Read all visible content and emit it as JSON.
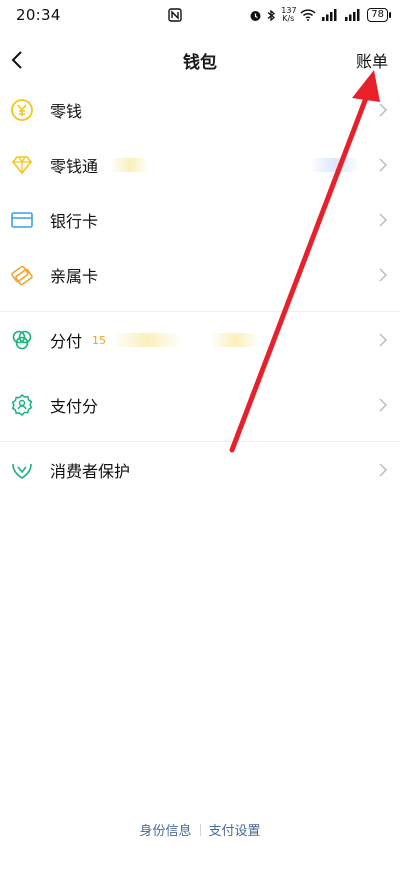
{
  "status": {
    "time": "20:34",
    "speed_top": "137",
    "speed_bottom": "K/s",
    "battery": "78"
  },
  "nav": {
    "title": "钱包",
    "right": "账单"
  },
  "list": [
    {
      "label": "零钱",
      "icon": "coin-icon"
    },
    {
      "label": "零钱通",
      "icon": "diamond-icon"
    },
    {
      "label": "银行卡",
      "icon": "card-icon"
    },
    {
      "label": "亲属卡",
      "icon": "family-card-icon"
    },
    {
      "label": "分付",
      "badge": "15",
      "icon": "installment-icon"
    },
    {
      "label": "支付分",
      "icon": "payscore-icon"
    },
    {
      "label": "消费者保护",
      "icon": "protection-icon"
    }
  ],
  "footer": {
    "left": "身份信息",
    "right": "支付设置"
  },
  "colors": {
    "green": "#19b37a",
    "yellow": "#f5c518",
    "blue": "#3aa0e8",
    "orange": "#f5a530",
    "arrow": "#e8202a"
  }
}
